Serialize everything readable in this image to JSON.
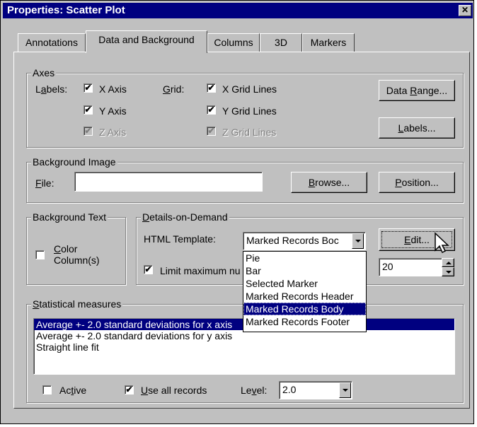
{
  "window": {
    "title": "Properties: Scatter Plot",
    "close_glyph": "✕"
  },
  "tabs": [
    {
      "label": "Annotations"
    },
    {
      "label": "Data and Background"
    },
    {
      "label": "Columns"
    },
    {
      "label": "3D"
    },
    {
      "label": "Markers"
    }
  ],
  "active_tab": "Data and Background",
  "axes": {
    "legend": "Axes",
    "labels_title": "Labels:",
    "grid_title": "Grid:",
    "labels": [
      {
        "text": "X Axis",
        "checked": true,
        "enabled": true
      },
      {
        "text": "Y Axis",
        "checked": true,
        "enabled": true
      },
      {
        "text": "Z Axis",
        "checked": true,
        "enabled": false
      }
    ],
    "grid": [
      {
        "text": "X Grid Lines",
        "checked": true,
        "enabled": true
      },
      {
        "text": "Y Grid Lines",
        "checked": true,
        "enabled": true
      },
      {
        "text": "Z Grid Lines",
        "checked": true,
        "enabled": false
      }
    ],
    "data_range_button": "Data Range...",
    "labels_button": "Labels..."
  },
  "background_image": {
    "legend": "Background Image",
    "file_label": "File:",
    "file_value": "",
    "browse_button": "Browse...",
    "position_button": "Position..."
  },
  "background_text": {
    "legend": "Background Text",
    "color_columns_line1": "Color",
    "color_columns_line2": "Column(s)",
    "color_columns_checked": false
  },
  "details_on_demand": {
    "legend": "Details-on-Demand",
    "template_label": "HTML Template:",
    "template_value": "Marked Records Boc",
    "edit_button": "Edit...",
    "limit_label": "Limit maximum nu",
    "limit_checked": true,
    "limit_value": "20",
    "template_options": [
      "Pie",
      "Bar",
      "Selected Marker",
      "Marked Records Header",
      "Marked Records Body",
      "Marked Records Footer"
    ],
    "selected_option": "Marked Records Body"
  },
  "statistical_measures": {
    "legend": "Statistical measures",
    "items": [
      "Average +- 2.0 standard deviations for x axis",
      "Average +- 2.0 standard deviations for y axis",
      "Straight line fit"
    ],
    "selected_index": 0,
    "active_label": "Active",
    "active_checked": false,
    "use_all_label": "Use all records",
    "use_all_checked": true,
    "level_label": "Level:",
    "level_value": "2.0"
  }
}
